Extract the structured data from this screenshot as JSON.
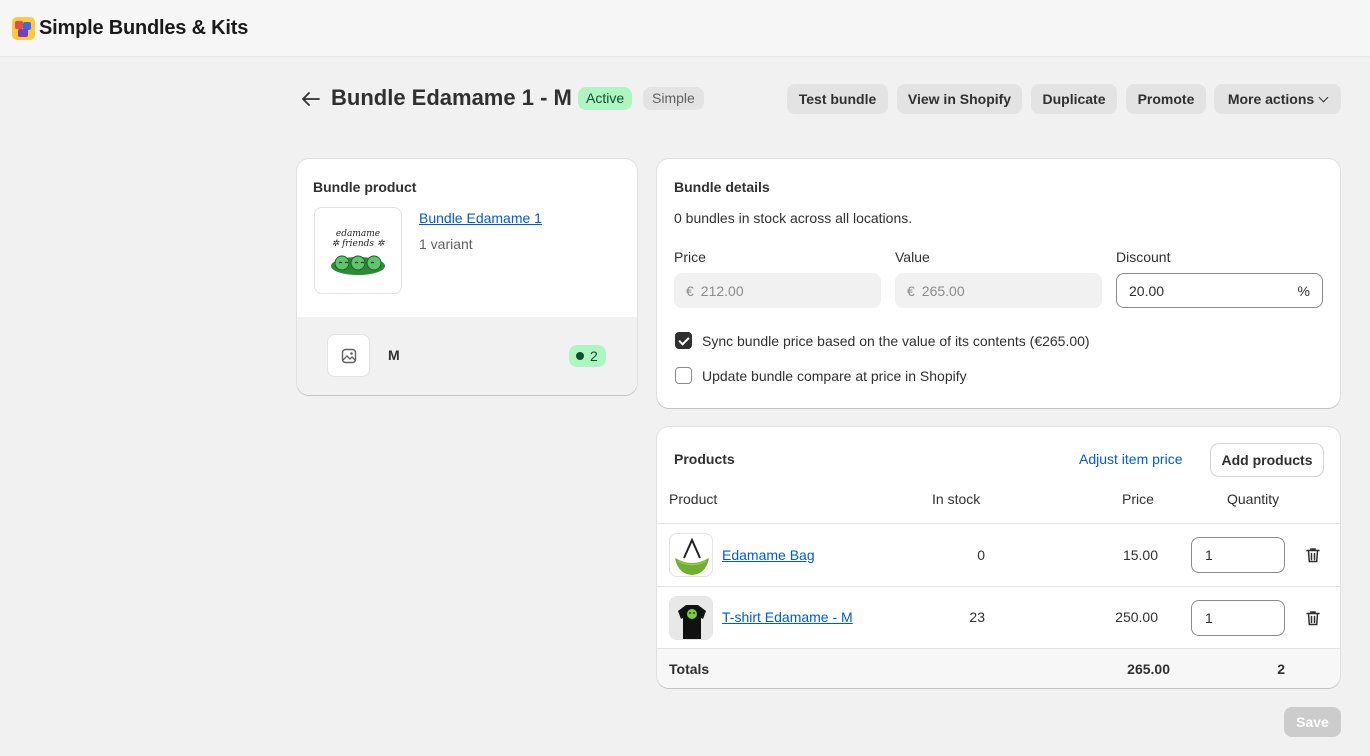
{
  "app": {
    "title": "Simple Bundles & Kits",
    "logo_icon": "app-logo-icon"
  },
  "header": {
    "back_icon": "←",
    "title": "Bundle Edamame 1 - M",
    "status_badge": "Active",
    "type_badge": "Simple",
    "actions": {
      "test": "Test bundle",
      "view": "View in Shopify",
      "duplicate": "Duplicate",
      "promote": "Promote",
      "more": "More actions"
    }
  },
  "bundle_product": {
    "title": "Bundle product",
    "product_name": "Bundle Edamame 1",
    "variants_count": "1 variant",
    "variant": {
      "name": "M",
      "stock": "2"
    }
  },
  "bundle_details": {
    "title": "Bundle details",
    "stock_text": "0 bundles in stock across all locations.",
    "price_label": "Price",
    "price_currency": "€",
    "price_value": "212.00",
    "value_label": "Value",
    "value_currency": "€",
    "value_value": "265.00",
    "discount_label": "Discount",
    "discount_value": "20.00",
    "discount_suffix": "%",
    "sync_label": "Sync bundle price based on the value of its contents (€265.00)",
    "sync_checked": true,
    "compare_label": "Update bundle compare at price in Shopify",
    "compare_checked": false
  },
  "products": {
    "title": "Products",
    "adjust_link": "Adjust item price",
    "add_button": "Add products",
    "columns": {
      "product": "Product",
      "in_stock": "In stock",
      "price": "Price",
      "quantity": "Quantity"
    },
    "rows": [
      {
        "name": "Edamame Bag",
        "in_stock": "0",
        "price": "15.00",
        "quantity": "1"
      },
      {
        "name": "T-shirt Edamame - M",
        "in_stock": "23",
        "price": "250.00",
        "quantity": "1"
      }
    ],
    "totals": {
      "label": "Totals",
      "price": "265.00",
      "quantity": "2"
    }
  },
  "save_button": "Save",
  "colors": {
    "accent_link": "#005bd3",
    "active_badge_bg": "#aff5c0",
    "active_badge_text": "#0c5132",
    "page_bg": "#f1f1f1"
  }
}
